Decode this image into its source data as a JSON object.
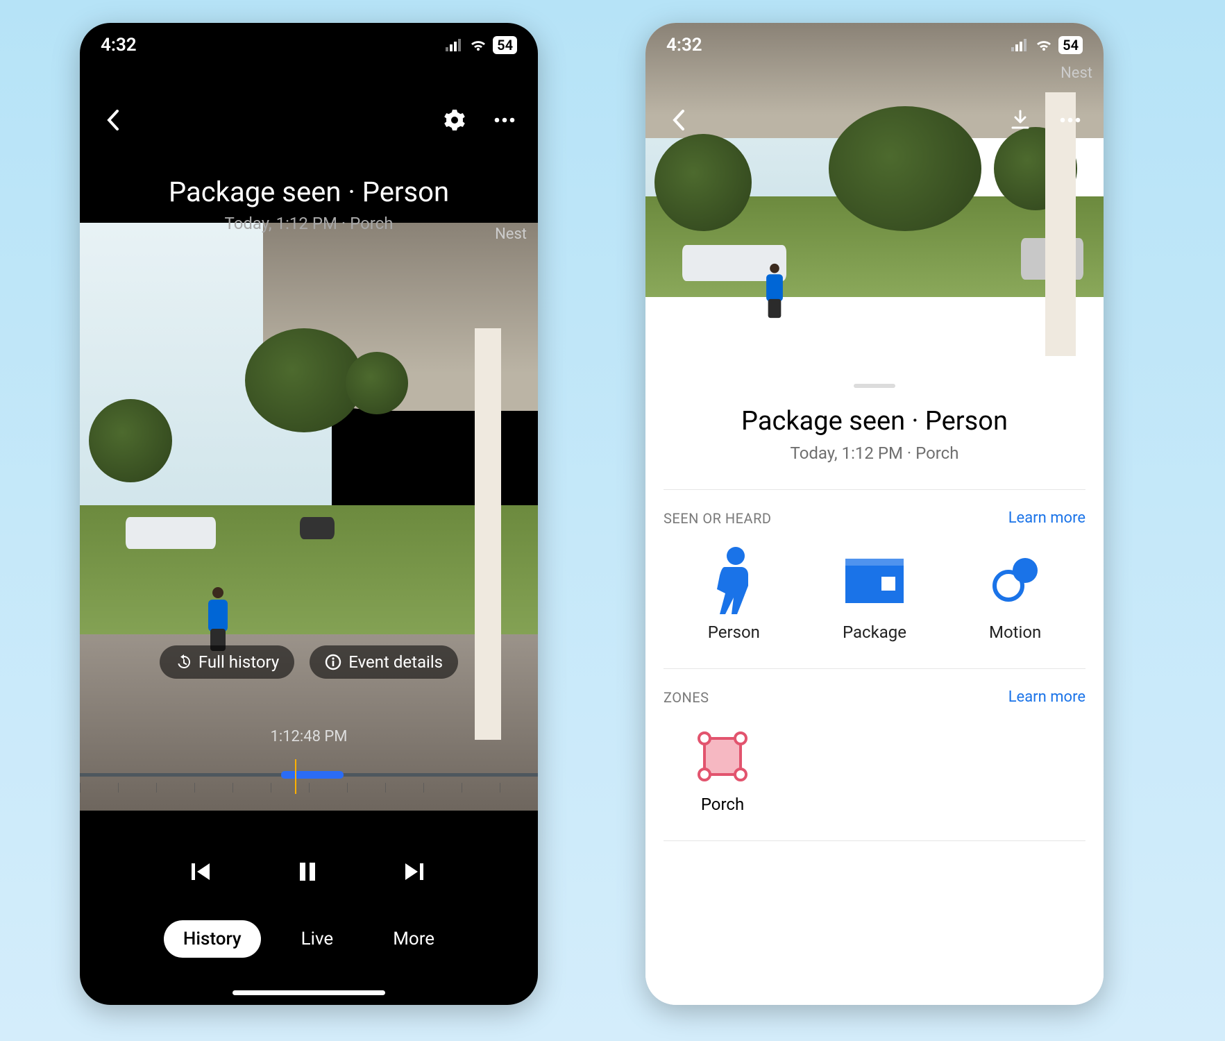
{
  "status": {
    "time": "4:32",
    "battery": "54"
  },
  "brand": "Nest",
  "left": {
    "event_title": "Package seen · Person",
    "event_subtitle": "Today, 1:12 PM · Porch",
    "pills": {
      "full_history": "Full history",
      "event_details": "Event details"
    },
    "timeline_time": "1:12:48 PM",
    "tabs": {
      "history": "History",
      "live": "Live",
      "more": "More"
    }
  },
  "right": {
    "event_title": "Package seen · Person",
    "event_subtitle": "Today, 1:12 PM · Porch",
    "sections": {
      "seen": {
        "label": "SEEN OR HEARD",
        "learn_more": "Learn more",
        "tiles": {
          "person": "Person",
          "package": "Package",
          "motion": "Motion"
        }
      },
      "zones": {
        "label": "ZONES",
        "learn_more": "Learn more",
        "items": {
          "porch": "Porch"
        }
      }
    }
  }
}
